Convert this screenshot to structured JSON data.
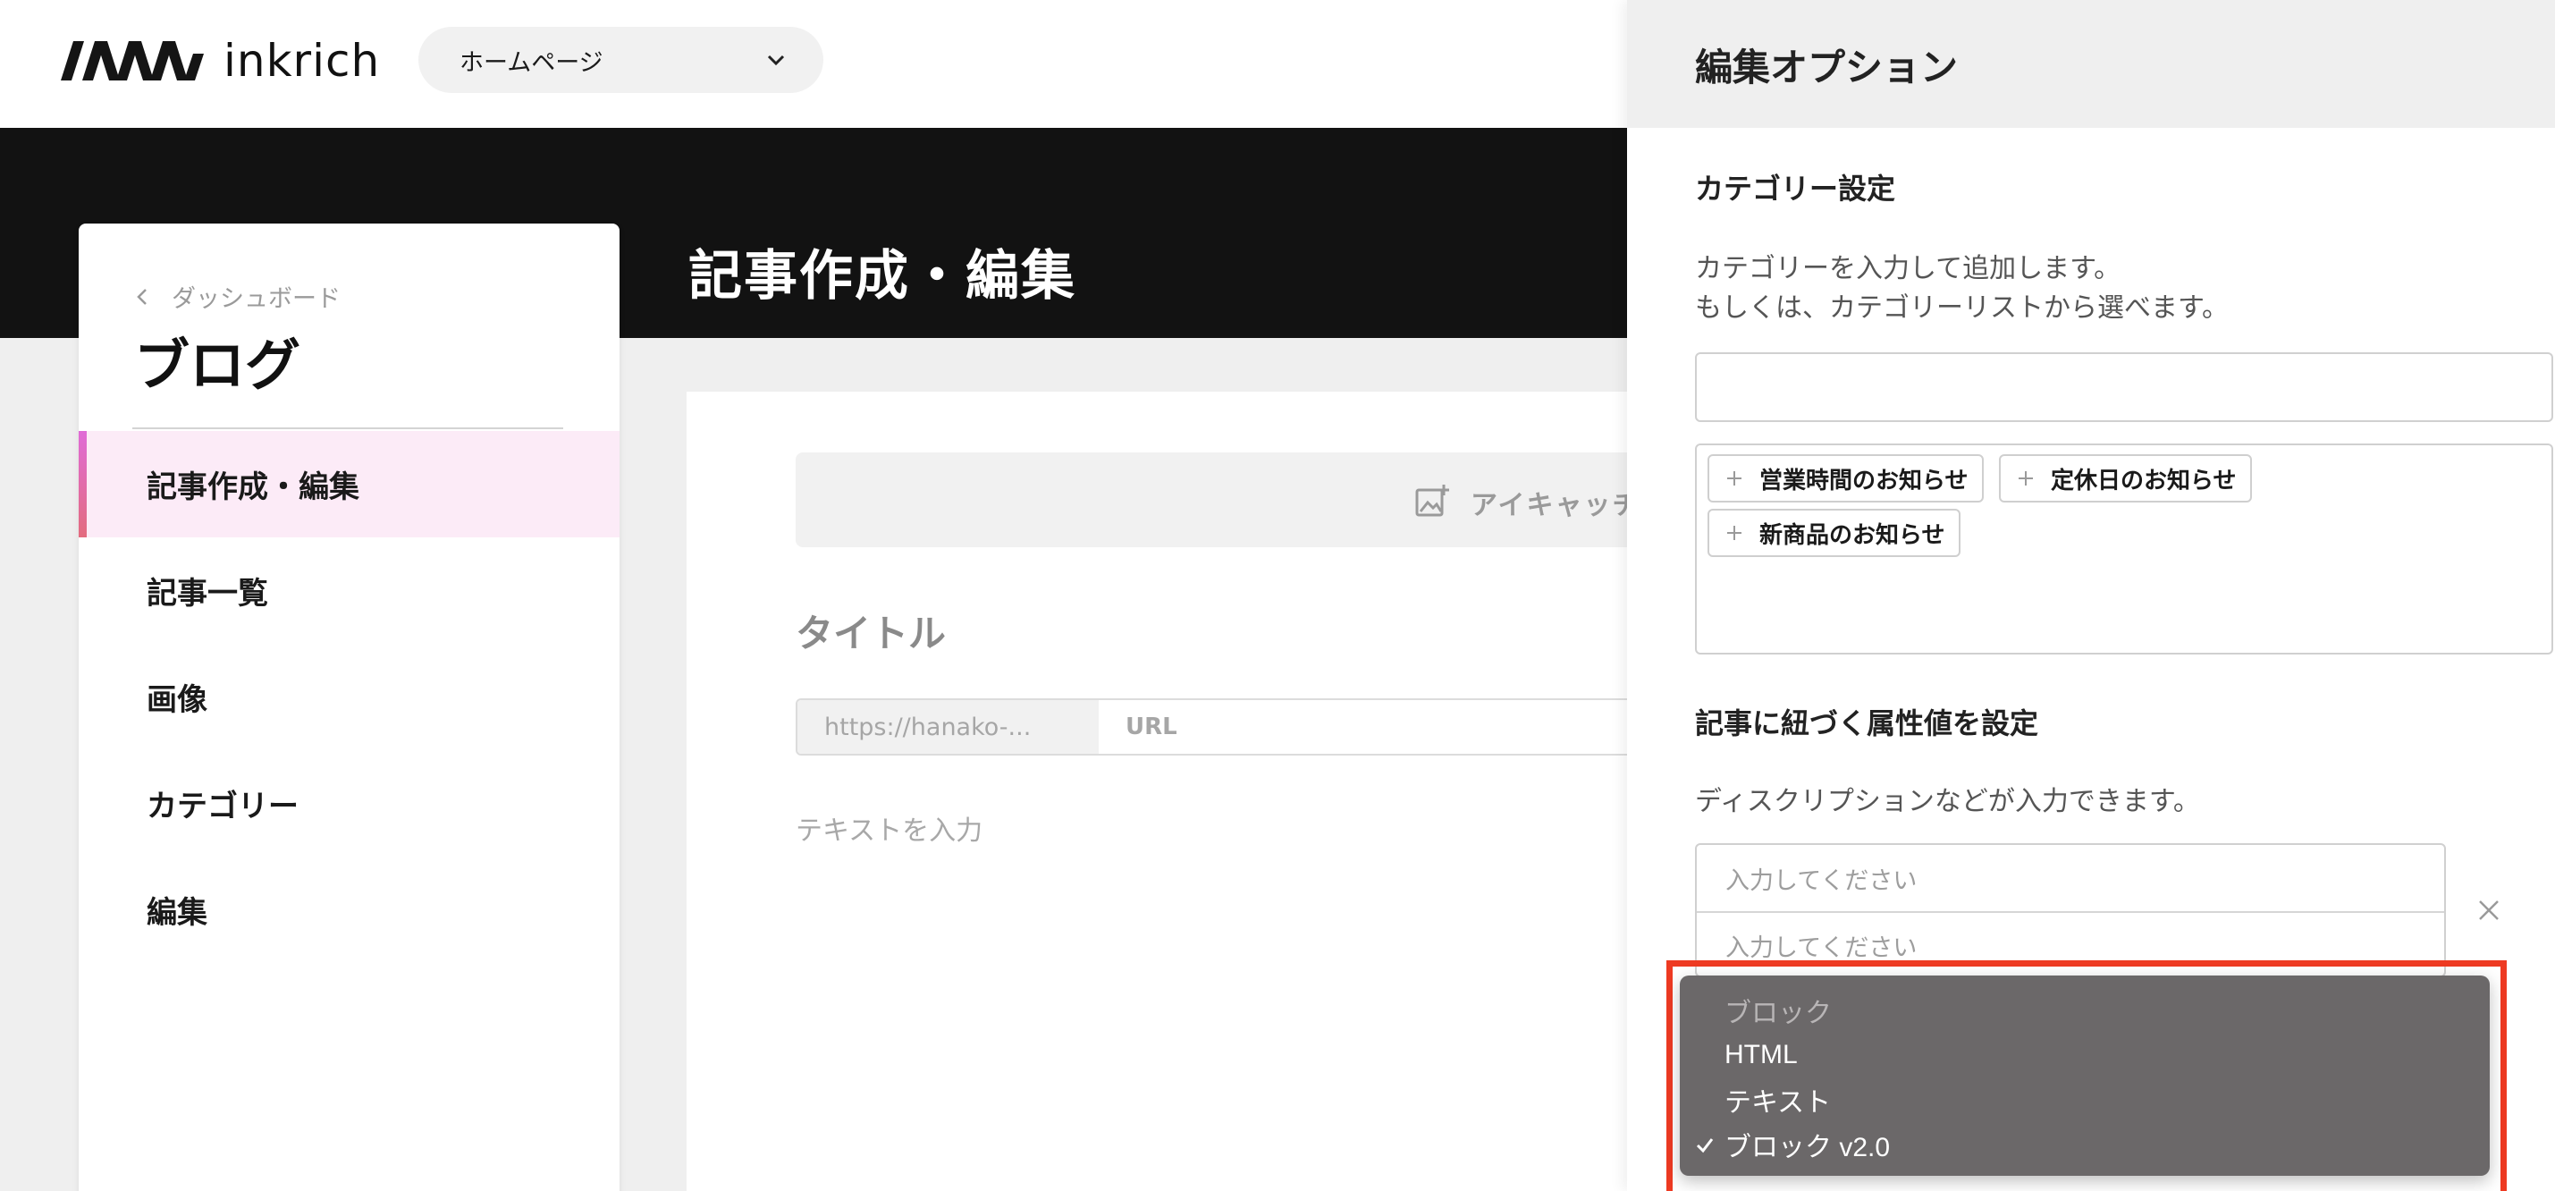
{
  "header": {
    "logo_text": "inkrich",
    "site_select_value": "ホームページ"
  },
  "banner": {
    "title": "記事作成・編集"
  },
  "sidebar": {
    "back_label": "ダッシュボード",
    "title": "ブログ",
    "items": [
      {
        "label": "記事作成・編集",
        "active": true
      },
      {
        "label": "記事一覧",
        "active": false
      },
      {
        "label": "画像",
        "active": false
      },
      {
        "label": "カテゴリー",
        "active": false
      },
      {
        "label": "編集",
        "active": false
      }
    ]
  },
  "editor": {
    "eyecatch_label": "アイキャッチ",
    "title_placeholder": "タイトル",
    "url_prefix": "https://hanako-...",
    "url_placeholder": "URL",
    "body_placeholder": "テキストを入力"
  },
  "panel": {
    "title": "編集オプション",
    "category": {
      "title": "カテゴリー設定",
      "help_line1": "カテゴリーを入力して追加します。",
      "help_line2": "もしくは、カテゴリーリストから選べます。",
      "input_value": "",
      "chips": [
        "営業時間のお知らせ",
        "定休日のお知らせ",
        "新商品のお知らせ"
      ]
    },
    "attributes": {
      "title": "記事に紐づく属性値を設定",
      "help": "ディスクリプションなどが入力できます。",
      "placeholder_1": "入力してください",
      "placeholder_2": "入力してください"
    }
  },
  "dropdown": {
    "options": [
      {
        "label": "ブロック",
        "disabled": true,
        "selected": false
      },
      {
        "label": "HTML",
        "disabled": false,
        "selected": false
      },
      {
        "label": "テキスト",
        "disabled": false,
        "selected": false
      },
      {
        "label": "ブロック v2.0",
        "disabled": false,
        "selected": true
      }
    ],
    "highlight_color": "#ee3a22",
    "menu_color": "#6b6869"
  },
  "colors": {
    "accent_pink": "#fcebf7",
    "accent_gradient_start": "#e06bd7",
    "banner": "#121212"
  }
}
